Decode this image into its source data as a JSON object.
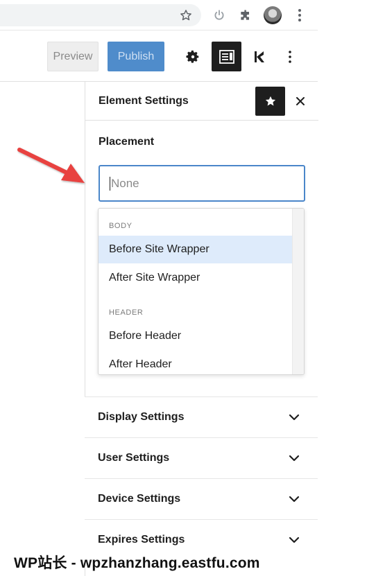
{
  "browser": {
    "icons": [
      "star-icon",
      "power-icon",
      "extensions-icon",
      "avatar",
      "more-vertical-icon"
    ]
  },
  "toolbar": {
    "preview_label": "Preview",
    "publish_label": "Publish",
    "icons": [
      "gear-icon",
      "editor-settings-icon",
      "kadence-logo-icon",
      "more-vertical-icon"
    ]
  },
  "sidebar": {
    "title": "Element Settings",
    "placement": {
      "label": "Placement",
      "placeholder": "None"
    },
    "dropdown": {
      "groups": [
        {
          "name": "BODY",
          "options": [
            "Before Site Wrapper",
            "After Site Wrapper"
          ]
        },
        {
          "name": "HEADER",
          "options": [
            "Before Header",
            "After Header"
          ]
        }
      ],
      "highlighted": "Before Site Wrapper"
    },
    "sections": [
      {
        "label": "Display Settings"
      },
      {
        "label": "User Settings"
      },
      {
        "label": "Device Settings"
      },
      {
        "label": "Expires Settings"
      }
    ]
  },
  "watermark": "WP站长 - wpzhanzhang.eastfu.com",
  "colors": {
    "accent_blue": "#4a86c9",
    "publish_blue": "#4f8ccb",
    "highlight": "#deebfb",
    "dark": "#1e1e1e",
    "arrow_red": "#e8423f"
  }
}
